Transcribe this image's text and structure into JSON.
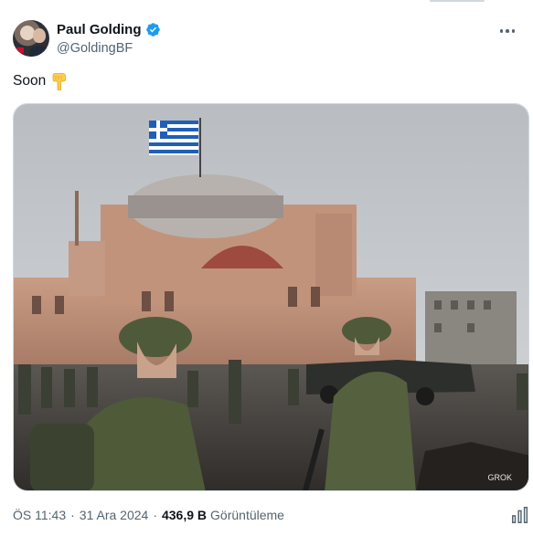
{
  "author": {
    "display_name": "Paul Golding",
    "handle": "@GoldingBF",
    "verified": true
  },
  "tweet": {
    "text": "Soon",
    "emoji": "pointing-down-hand-icon"
  },
  "media": {
    "watermark": "GROK"
  },
  "meta": {
    "time": "ÖS 11:43",
    "date": "31 Ara 2024",
    "views_count": "436,9 B",
    "views_label": "Görüntüleme",
    "separator": "·"
  },
  "colors": {
    "text": "#0f1419",
    "secondary": "#536471",
    "verified_badge": "#1d9bf0",
    "border": "#cfd9de"
  }
}
